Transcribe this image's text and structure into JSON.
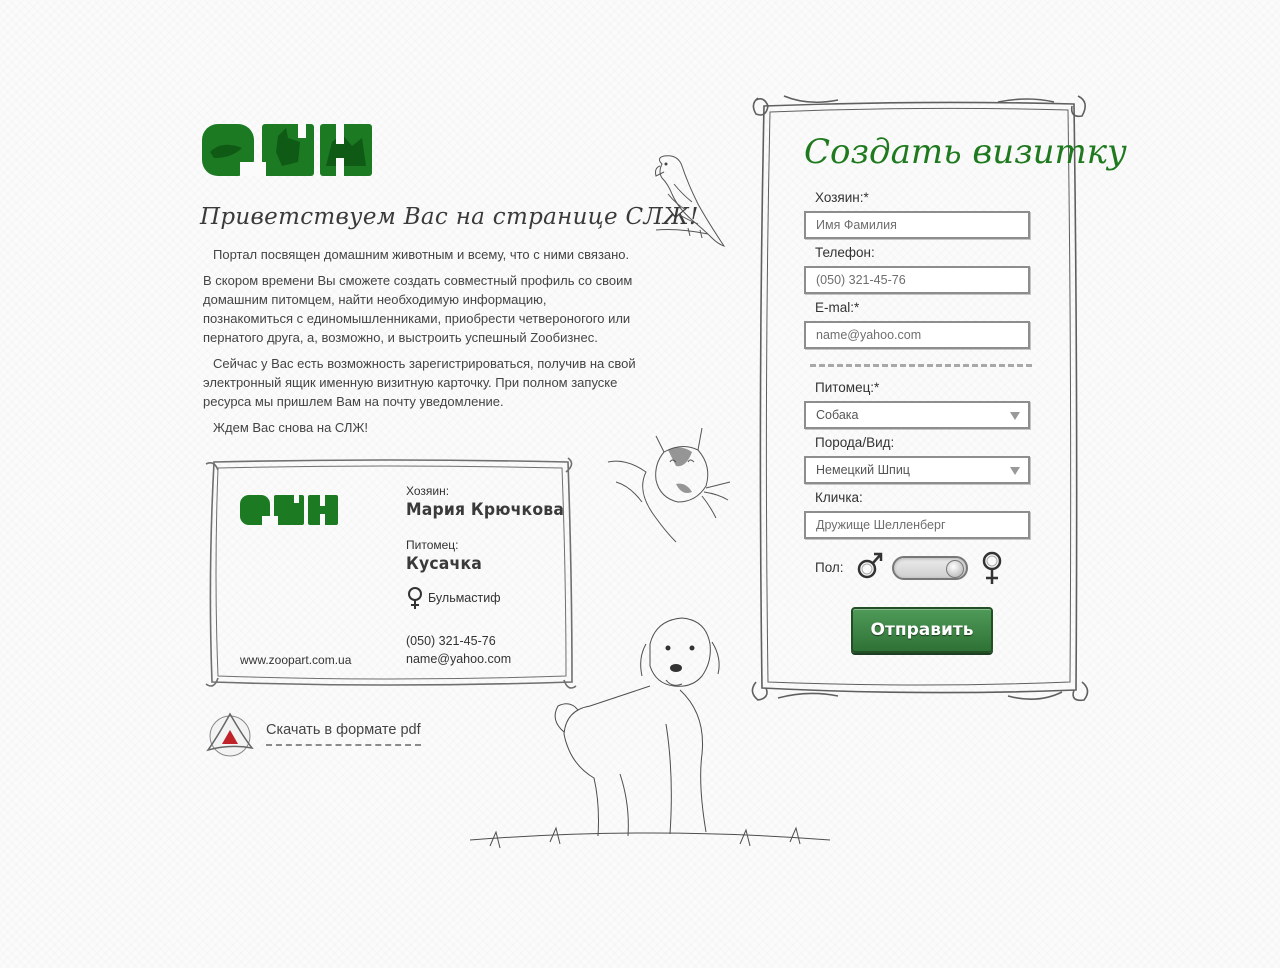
{
  "brand": {
    "logo_text": "СЛЖ",
    "green": "#1b7a22",
    "dark_green": "#0f5a14"
  },
  "welcome": {
    "title": "Приветствуем Вас на странице СЛЖ!",
    "p1": "Портал посвящен домашним животным и всему, что с ними связано.",
    "p2": "В скором времени Вы сможете создать совместный профиль со своим домашним питомцем, найти необходимую информацию, познакомиться с единомышленниками, приобрести четвероногого или пернатого друга, а, возможно, и выстроить успешный Zooбизнес.",
    "p3": "Сейчас у Вас есть возможность зарегистрироваться, получив на свой электронный ящик именную визитную карточку. При полном запуске ресурса мы пришлем Вам на почту уведомление.",
    "p4": "Ждем Вас снова на СЛЖ!"
  },
  "card": {
    "owner_label": "Хозяин:",
    "owner_name": "Мария Крючкова",
    "pet_label": "Питомец:",
    "pet_name": "Кусачка",
    "pet_gender_icon": "female-icon",
    "breed": "Бульмастиф",
    "phone": "(050) 321-45-76",
    "email": "name@yahoo.com",
    "url": "www.zoopart.com.ua"
  },
  "download": {
    "label": "Скачать в формате pdf",
    "icon": "pdf-icon"
  },
  "form": {
    "title": "Создать визитку",
    "owner_label": "Хозяин:*",
    "owner_placeholder": "Имя Фамилия",
    "phone_label": "Телефон:",
    "phone_placeholder": "(050) 321-45-76",
    "email_label": "E-mal:*",
    "email_placeholder": "name@yahoo.com",
    "pet_label": "Питомец:*",
    "pet_value": "Собака",
    "breed_label": "Порода/Вид:",
    "breed_value": "Немецкий Шпиц",
    "nickname_label": "Кличка:",
    "nickname_placeholder": "Дружище Шелленберг",
    "gender_label": "Пол:",
    "gender_male_icon": "male-icon",
    "gender_female_icon": "female-icon",
    "gender_toggle_state": "female",
    "submit_label": "Отправить",
    "submit_color": "#3f8a48"
  }
}
